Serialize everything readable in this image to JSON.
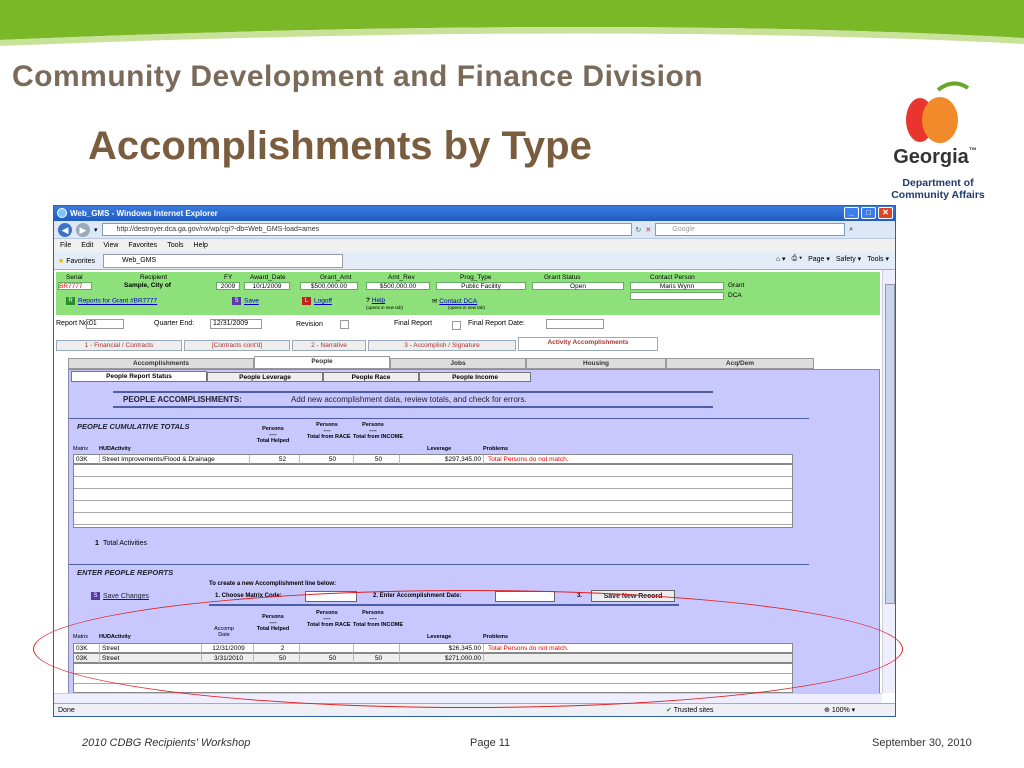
{
  "slide": {
    "division": "Community Development and Finance Division",
    "title": "Accomplishments by Type"
  },
  "logo": {
    "name": "Georgia",
    "trademark": "™",
    "dept_line1": "Department of",
    "dept_line2": "Community Affairs"
  },
  "footer": {
    "left": "2010 CDBG Recipients' Workshop",
    "center": "Page 11",
    "right": "September 30, 2010"
  },
  "browser": {
    "title": "Web_GMS - Windows Internet Explorer",
    "address": "http://destroyer.dca.ga.gov/nx/wp/cgi?-db=Web_GMS-load=ames",
    "search_placeholder": "Google",
    "menu": [
      "File",
      "Edit",
      "View",
      "Favorites",
      "Tools",
      "Help"
    ],
    "favorites": "Favorites",
    "tab": "Web_GMS",
    "cmd": [
      "Page ▾",
      "Safety ▾",
      "Tools ▾"
    ],
    "status": "Done",
    "trusted": "Trusted sites",
    "zoom": "100%"
  },
  "grant": {
    "labels": {
      "serial": "Serial",
      "recipient": "Recipient",
      "fy": "FY",
      "award_date": "Award_Date",
      "grant_amt": "Grant_Amt",
      "amt_rev": "Amt_Rev",
      "prog_type": "Prog_Type",
      "grant_status": "Grant Status",
      "contact": "Contact Person"
    },
    "serial": "BR7777",
    "recipient": "Sample, City of",
    "fy": "2009",
    "award_date": "10/1/2009",
    "grant_amt": "$500,000.00",
    "amt_rev": "$500,000.00",
    "prog_type": "Public Facility",
    "status": "Open",
    "contact": "Maris Wynn",
    "contact_org1": "Grant",
    "contact_org2": "DCA",
    "reports_link": "Reports for Grant #BR7777",
    "save": "Save",
    "logoff": "Logoff",
    "help": "Help",
    "help_note": "(opens in new tab)",
    "contact_dca": "Contact DCA",
    "contact_note": "(opens in new tab)"
  },
  "report": {
    "report_no_label": "Report No:",
    "report_no": "01",
    "quarter_label": "Quarter End:",
    "quarter_end": "12/31/2009",
    "revision_label": "Revision",
    "final_label": "Final Report",
    "final_date_label": "Final Report Date:"
  },
  "tabs_top": [
    "1 - Financial / Contracts",
    "[Contracts cont'd]",
    "2 - Narrative",
    "3 - Accomplish / Signature",
    "Activity Accomplishments"
  ],
  "tabs_second": [
    "Accomplishments",
    "People",
    "Jobs",
    "Housing",
    "Acq/Dem"
  ],
  "tabs_third": [
    "People Report Status",
    "People Leverage",
    "People Race",
    "People Income"
  ],
  "banner": {
    "title": "PEOPLE ACCOMPLISHMENTS:",
    "text": "Add new accomplishment data, review totals, and check for errors."
  },
  "cumulative": {
    "title": "PEOPLE CUMULATIVE TOTALS",
    "headers": {
      "matrix": "Matrix",
      "hud": "HUDActivity",
      "persons": "Persons",
      "dash": "----",
      "total_helped": "Total Helped",
      "total_race": "Total from RACE",
      "total_income": "Total from INCOME",
      "leverage": "Leverage",
      "problems": "Problems"
    },
    "rows": [
      {
        "matrix": "03K",
        "activity": "Street Improvements/Flood & Drainage",
        "helped": "52",
        "race": "50",
        "income": "50",
        "leverage": "$297,345.00",
        "problem": "Total Persons do not match."
      }
    ],
    "total": "1",
    "total_label": "Total Activities"
  },
  "enter": {
    "title": "ENTER PEOPLE REPORTS",
    "instructions": "To create a new Accomplishment line below:",
    "step1": "1. Choose Matrix Code:",
    "step2": "2. Enter Accomplishment Date:",
    "step3": "3.",
    "save_changes": "Save Changes",
    "save_new": "Save New Record",
    "headers": {
      "accomp": "Accomp",
      "date": "Date"
    },
    "rows": [
      {
        "matrix": "03K",
        "activity": "Street",
        "date": "12/31/2009",
        "helped": "2",
        "race": "",
        "income": "",
        "leverage": "$26,345.00",
        "problem": "Total Persons do not match."
      },
      {
        "matrix": "03K",
        "activity": "Street",
        "date": "3/31/2010",
        "helped": "50",
        "race": "50",
        "income": "50",
        "leverage": "$271,000.00",
        "problem": ""
      }
    ]
  }
}
